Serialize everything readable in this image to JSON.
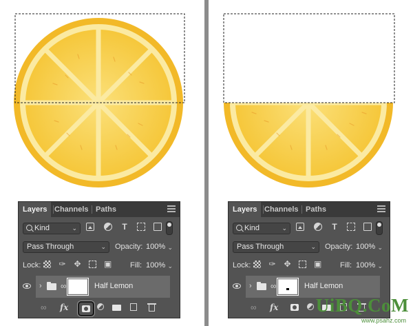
{
  "panels": [
    {
      "tabs": [
        "Layers",
        "Channels",
        "Paths"
      ],
      "filter_kind": "Kind",
      "blend_mode": "Pass Through",
      "opacity_label": "Opacity:",
      "opacity_value": "100%",
      "lock_label": "Lock:",
      "fill_label": "Fill:",
      "fill_value": "100%",
      "layer_name": "Half Lemon",
      "fx_label": "fx",
      "filter_type_glyph": "T"
    },
    {
      "tabs": [
        "Layers",
        "Channels",
        "Paths"
      ],
      "filter_kind": "Kind",
      "blend_mode": "Pass Through",
      "opacity_label": "Opacity:",
      "opacity_value": "100%",
      "lock_label": "Lock:",
      "fill_label": "Fill:",
      "fill_value": "100%",
      "layer_name": "Half Lemon",
      "fx_label": "fx",
      "filter_type_glyph": "T"
    }
  ],
  "icons": {
    "panel_menu": "hamburger-menu-icon",
    "search": "magnifier-icon",
    "visibility": "eye-icon",
    "group": "folder-icon",
    "link": "chain-link-icon",
    "add_mask": "layer-mask-icon",
    "new_fill": "half-circle-adjustment-icon",
    "new_layer": "new-page-icon",
    "delete": "trash-icon"
  },
  "colors": {
    "lemon_peel": "#f2b928",
    "lemon_pith": "#fbeaa2",
    "lemon_segment": "#f7cb44",
    "panel_bg": "#535353",
    "tab_bar_bg": "#3a3a3a",
    "selected_row_bg": "#6b6b6b",
    "divider": "#8c8c8c",
    "watermark": "#4c8f3a"
  },
  "watermark": {
    "logo": "UiBQ.CoM",
    "url": "www.psahz.com"
  }
}
